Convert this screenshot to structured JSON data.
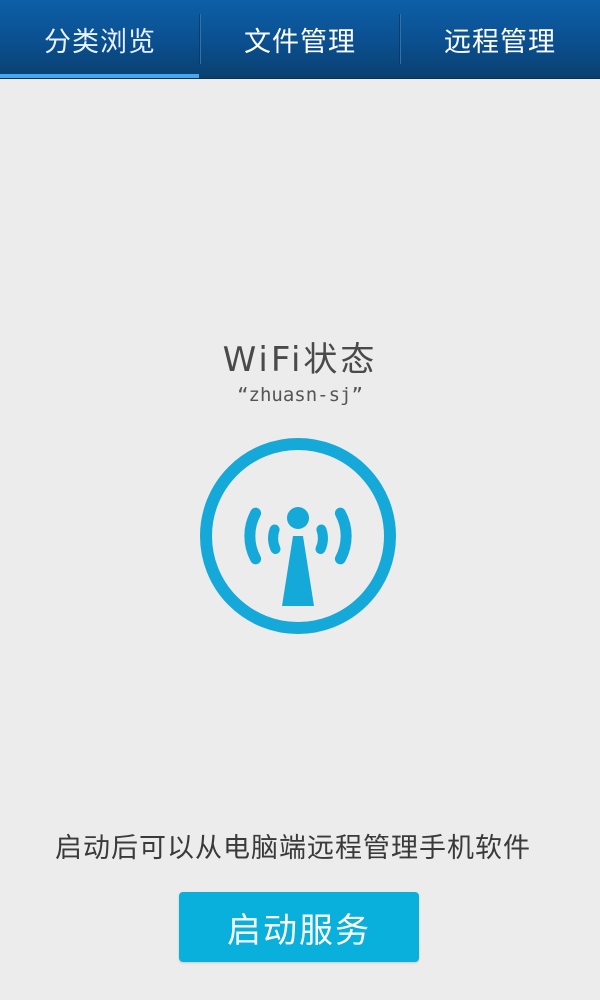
{
  "tabs": [
    {
      "label": "分类浏览",
      "active": true
    },
    {
      "label": "文件管理",
      "active": false
    },
    {
      "label": "远程管理",
      "active": false
    }
  ],
  "wifi": {
    "title": "WiFi状态",
    "ssid": "“zhuasn-sj”",
    "icon": "wifi-antenna-icon",
    "icon_color": "#14a9d8"
  },
  "hint": "启动后可以从电脑端远程管理手机软件",
  "start_button": {
    "label": "启动服务",
    "color": "#0ab0dc"
  },
  "colors": {
    "tabbar": "#0b4f8f",
    "tab_indicator": "#46a8f0",
    "background": "#ececec"
  }
}
